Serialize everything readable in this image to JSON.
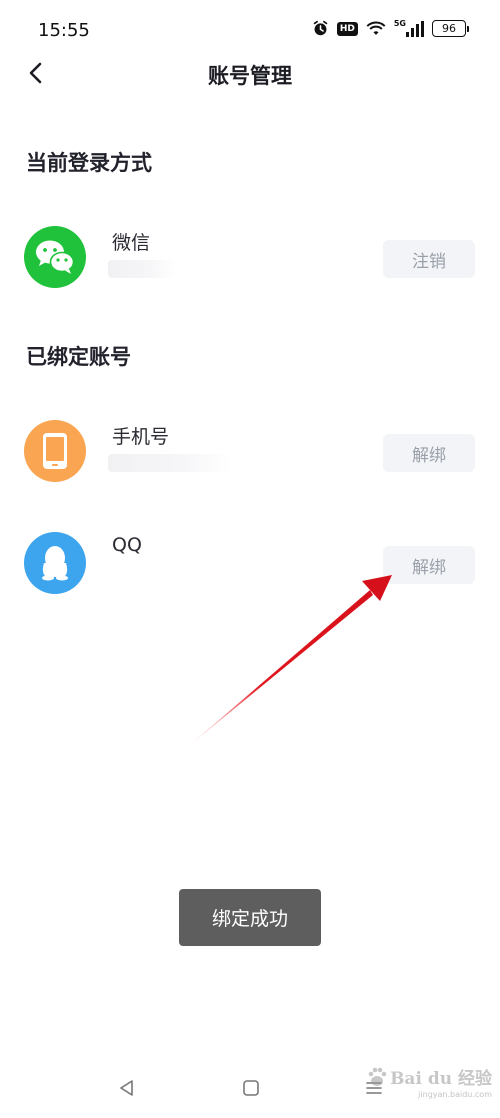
{
  "status_bar": {
    "time": "15:55",
    "hd": "HD",
    "network": "5G",
    "battery": "96"
  },
  "nav": {
    "title": "账号管理"
  },
  "current_login": {
    "heading": "当前登录方式",
    "item": {
      "label": "微信",
      "action": "注销",
      "icon": "wechat-icon",
      "color": "#21c23b"
    }
  },
  "bound_accounts": {
    "heading": "已绑定账号",
    "items": [
      {
        "label": "手机号",
        "action": "解绑",
        "icon": "phone-icon",
        "color": "#f9a552"
      },
      {
        "label": "QQ",
        "action": "解绑",
        "icon": "qq-icon",
        "color": "#3da5ee"
      }
    ]
  },
  "toast": {
    "message": "绑定成功"
  },
  "watermark": {
    "text": "Bai du 经验",
    "url": "jingyan.baidu.com"
  },
  "colors": {
    "annotation_arrow": "#e0161e",
    "button_bg": "#f3f4f7",
    "button_text": "#9aa0aa"
  }
}
